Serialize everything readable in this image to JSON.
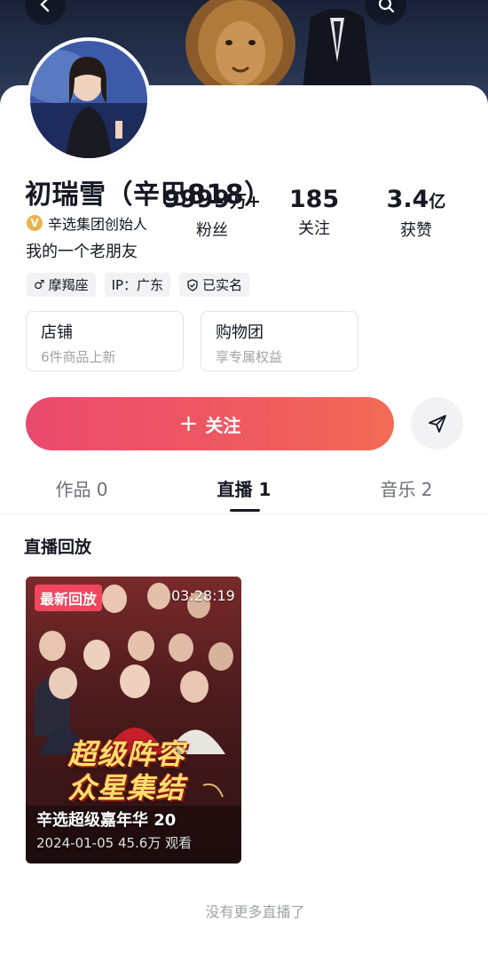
{
  "profile": {
    "name": "初瑞雪（辛巴818）",
    "verification": "辛选集团创始人",
    "bio": "我的一个老朋友",
    "tags": {
      "zodiac": "摩羯座",
      "ip": "IP：广东",
      "realname": "已实名"
    }
  },
  "stats": {
    "fans_value": "9999",
    "fans_unit": "万+",
    "fans_label": "粉丝",
    "following_value": "185",
    "following_label": "关注",
    "likes_value": "3.4",
    "likes_unit": "亿",
    "likes_label": "获赞"
  },
  "shop": {
    "store_title": "店铺",
    "store_sub": "6件商品上新",
    "group_title": "购物团",
    "group_sub": "享专属权益"
  },
  "actions": {
    "follow_label": "关注"
  },
  "tabs": {
    "works": "作品 0",
    "live": "直播 1",
    "music": "音乐 2"
  },
  "live_section": {
    "title": "直播回放",
    "items": [
      {
        "badge": "最新回放",
        "duration": "03:28:19",
        "poster_line1": "超级阵容",
        "poster_line2": "众星集结",
        "title": "辛选超级嘉年华 20",
        "meta": "2024-01-05 45.6万 观看"
      }
    ],
    "footer": "没有更多直播了"
  },
  "colors": {
    "follow_gradient_start": "#ea4a6d",
    "follow_gradient_end": "#f26b55",
    "badge_red": "#f0475e",
    "verify_gold": "#e8b54a"
  }
}
